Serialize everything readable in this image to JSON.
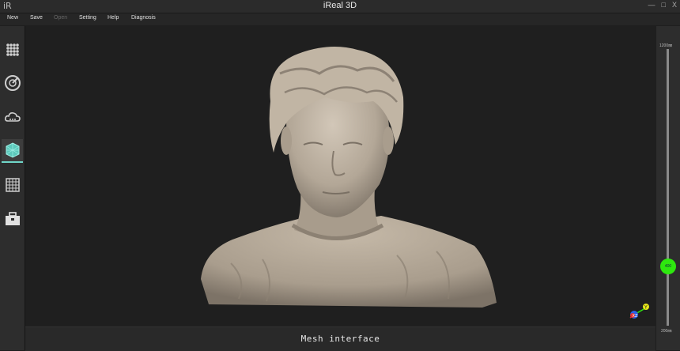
{
  "window": {
    "title": "iReal 3D",
    "logo": "iR"
  },
  "controls": {
    "minimize": "—",
    "maximize": "□",
    "close": "X"
  },
  "menu": {
    "items": [
      "New",
      "Save",
      "Open",
      "Setting",
      "Help",
      "Diagnosis"
    ]
  },
  "sidebar": {
    "icons": [
      "grid-dots-icon",
      "radar-scan-icon",
      "cloud-icon",
      "mesh-cube-icon",
      "grid-frame-icon",
      "toolbox-icon"
    ],
    "active": "mesh-cube-icon"
  },
  "status": {
    "text": "Mesh interface"
  },
  "slider": {
    "max_label": "1200㎜",
    "min_label": "200㎜",
    "value": "400",
    "color": "#2ee80f"
  },
  "axes": {
    "y_label": "Y",
    "z_label": "Z",
    "x_label": "X"
  },
  "colors": {
    "accent": "#6fd6c8",
    "model": "#b6aa9a"
  }
}
